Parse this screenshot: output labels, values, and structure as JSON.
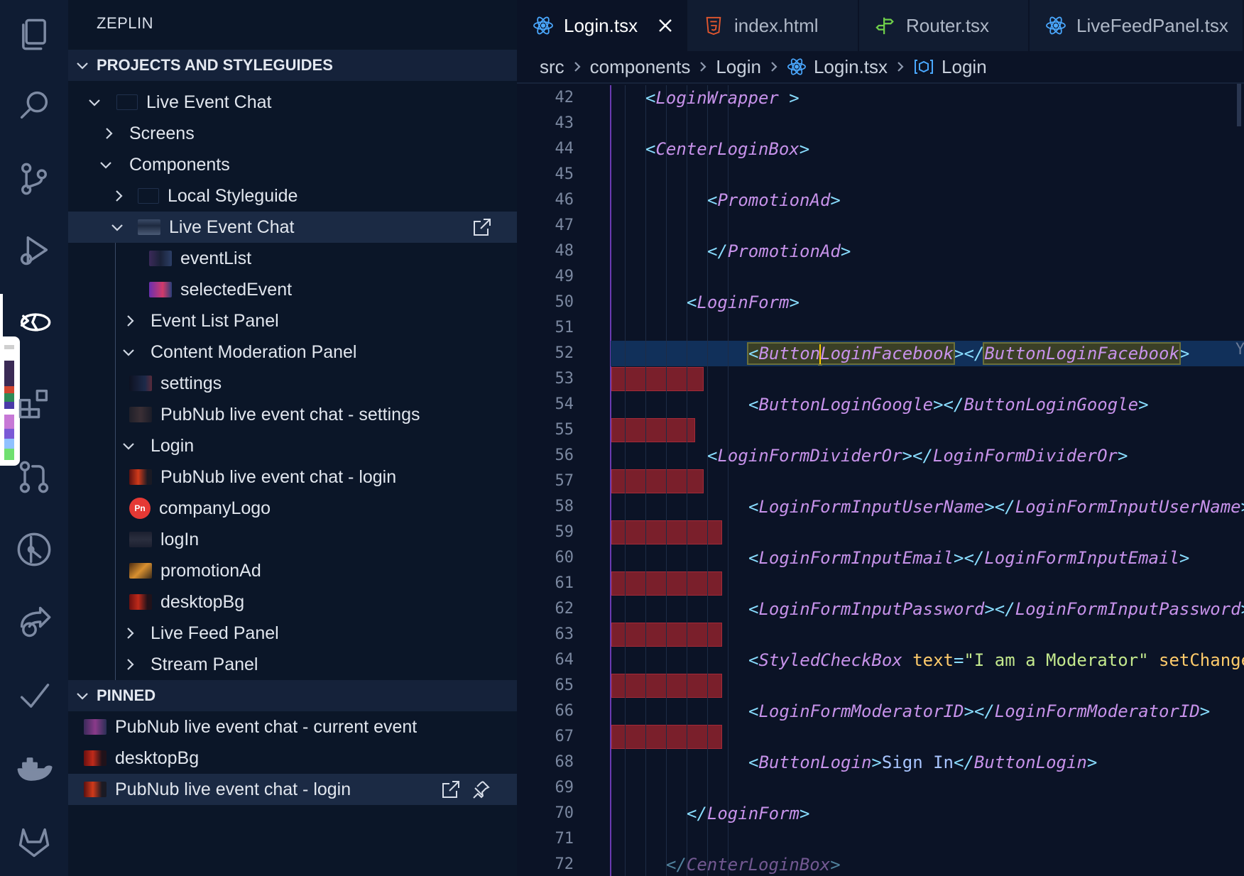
{
  "activity_bar": {
    "items": [
      {
        "name": "explorer-icon"
      },
      {
        "name": "search-icon"
      },
      {
        "name": "source-control-icon"
      },
      {
        "name": "run-debug-icon"
      },
      {
        "name": "zeplin-icon"
      },
      {
        "name": "extensions-icon"
      },
      {
        "name": "pull-request-icon"
      },
      {
        "name": "git-graph-icon"
      },
      {
        "name": "live-share-icon"
      },
      {
        "name": "checklist-icon"
      },
      {
        "name": "docker-icon"
      },
      {
        "name": "gitlab-icon"
      }
    ],
    "active_index": 4,
    "palette": [
      "#3a2a55",
      "#d1452f",
      "#2e8b57",
      "#4a3aa8",
      "#7a59d6",
      "#c778d6",
      "#8fc1ff",
      "#6fe06f"
    ]
  },
  "sidebar": {
    "title": "ZEPLIN",
    "section_projects": "PROJECTS AND STYLEGUIDES",
    "section_pinned": "PINNED",
    "tree": [
      {
        "label": "Live Event Chat",
        "expanded": true
      },
      {
        "label": "Screens",
        "expanded": false
      },
      {
        "label": "Components",
        "expanded": true
      },
      {
        "label": "Local Styleguide",
        "expanded": false
      },
      {
        "label": "Live Event Chat",
        "expanded": true,
        "selected": true
      },
      {
        "label": "eventList"
      },
      {
        "label": "selectedEvent"
      },
      {
        "label": "Event List Panel",
        "expanded": false
      },
      {
        "label": "Content Moderation Panel",
        "expanded": true
      },
      {
        "label": "settings"
      },
      {
        "label": "PubNub live event chat - settings"
      },
      {
        "label": "Login",
        "expanded": true
      },
      {
        "label": "PubNub live event chat - login"
      },
      {
        "label": "companyLogo",
        "badge": "Pn"
      },
      {
        "label": "logIn"
      },
      {
        "label": "promotionAd"
      },
      {
        "label": "desktopBg"
      },
      {
        "label": "Live Feed Panel",
        "expanded": false
      },
      {
        "label": "Stream Panel",
        "expanded": false
      }
    ],
    "pinned": [
      {
        "label": "PubNub live event chat - current event"
      },
      {
        "label": "desktopBg"
      },
      {
        "label": "PubNub live event chat - login",
        "selected": true
      }
    ]
  },
  "editor": {
    "tabs": [
      {
        "label": "Login.tsx",
        "icon": "react-icon",
        "active": true
      },
      {
        "label": "index.html",
        "icon": "html5-icon"
      },
      {
        "label": "Router.tsx",
        "icon": "router-icon"
      },
      {
        "label": "LiveFeedPanel.tsx",
        "icon": "react-icon"
      }
    ],
    "breadcrumb": [
      "src",
      "components",
      "Login",
      "Login.tsx",
      "Login"
    ],
    "lines": [
      {
        "n": "42",
        "indent": 1,
        "code": "<LoginWrapper >"
      },
      {
        "n": "43",
        "indent": 0,
        "code": ""
      },
      {
        "n": "44",
        "indent": 1,
        "code": "<CenterLoginBox>"
      },
      {
        "n": "45",
        "indent": 0,
        "code": ""
      },
      {
        "n": "46",
        "indent": 4,
        "code": "<PromotionAd>"
      },
      {
        "n": "47",
        "indent": 0,
        "code": ""
      },
      {
        "n": "48",
        "indent": 4,
        "code": "</PromotionAd>"
      },
      {
        "n": "49",
        "indent": 0,
        "code": ""
      },
      {
        "n": "50",
        "indent": 3,
        "code": "<LoginForm>"
      },
      {
        "n": "51",
        "indent": 0,
        "code": ""
      },
      {
        "n": "52",
        "indent": 6,
        "code": "<ButtonLoginFacebook></ButtonLoginFacebook>"
      },
      {
        "n": "53",
        "indent": 0,
        "code": ""
      },
      {
        "n": "54",
        "indent": 6,
        "code": "<ButtonLoginGoogle></ButtonLoginGoogle>"
      },
      {
        "n": "55",
        "indent": 0,
        "code": ""
      },
      {
        "n": "56",
        "indent": 4,
        "code": "<LoginFormDividerOr></LoginFormDividerOr>"
      },
      {
        "n": "57",
        "indent": 0,
        "code": ""
      },
      {
        "n": "58",
        "indent": 6,
        "code": "<LoginFormInputUserName></LoginFormInputUserName>"
      },
      {
        "n": "59",
        "indent": 0,
        "code": ""
      },
      {
        "n": "60",
        "indent": 6,
        "code": "<LoginFormInputEmail></LoginFormInputEmail>"
      },
      {
        "n": "61",
        "indent": 0,
        "code": ""
      },
      {
        "n": "62",
        "indent": 6,
        "code": "<LoginFormInputPassword></LoginFormInputPassword>"
      },
      {
        "n": "63",
        "indent": 0,
        "code": ""
      },
      {
        "n": "64",
        "indent": 6,
        "code": "<StyledCheckBox text=\"I am a Moderator\" setChange="
      },
      {
        "n": "65",
        "indent": 0,
        "code": ""
      },
      {
        "n": "66",
        "indent": 6,
        "code": "<LoginFormModeratorID></LoginFormModeratorID>"
      },
      {
        "n": "67",
        "indent": 0,
        "code": ""
      },
      {
        "n": "68",
        "indent": 6,
        "code": "<ButtonLogin>Sign In</ButtonLogin>"
      },
      {
        "n": "69",
        "indent": 0,
        "code": ""
      },
      {
        "n": "70",
        "indent": 3,
        "code": "</LoginForm>"
      },
      {
        "n": "71",
        "indent": 0,
        "code": ""
      },
      {
        "n": "72",
        "indent": 2,
        "code": "</CenterLoginBox>"
      }
    ],
    "overflow_marker": "Y"
  }
}
